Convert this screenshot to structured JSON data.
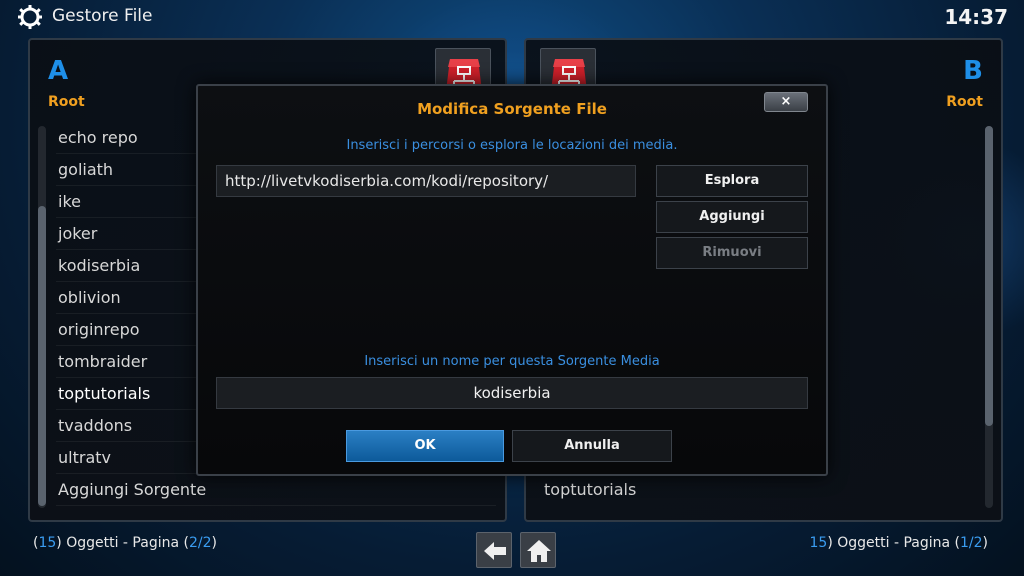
{
  "topbar": {
    "title": "Gestore File",
    "clock": "14:37"
  },
  "panel_a": {
    "letter": "A",
    "sub": "Root",
    "items": [
      "echo repo",
      "goliath",
      "ike",
      "joker",
      "kodiserbia",
      "oblivion",
      "originrepo",
      "tombraider",
      "toptutorials",
      "tvaddons",
      "ultratv",
      "Aggiungi Sorgente"
    ],
    "status": {
      "count": "15",
      "label_mid": ") Oggetti - Pagina (",
      "page": "2/2",
      "close": ")"
    }
  },
  "panel_b": {
    "letter": "B",
    "sub": "Root",
    "visible_item": "toptutorials",
    "status": {
      "count": "15",
      "label_mid": ") Oggetti - Pagina (",
      "page": "1/2",
      "close": ")"
    }
  },
  "dialog": {
    "title": "Modifica Sorgente File",
    "close_label": "×",
    "hint_paths": "Inserisci i percorsi o esplora le locazioni dei media.",
    "path_value": "http://livetvkodiserbia.com/kodi/repository/",
    "btn_browse": "Esplora",
    "btn_add": "Aggiungi",
    "btn_remove": "Rimuovi",
    "hint_name": "Inserisci un nome per questa Sorgente Media",
    "name_value": "kodiserbia",
    "btn_ok": "OK",
    "btn_cancel": "Annulla"
  },
  "nav": {
    "back_icon": "back-arrow-icon",
    "home_icon": "home-icon"
  },
  "colors": {
    "accent_blue": "#1e8fe8",
    "accent_orange": "#f0a020",
    "hint_blue": "#3a8fe0"
  }
}
